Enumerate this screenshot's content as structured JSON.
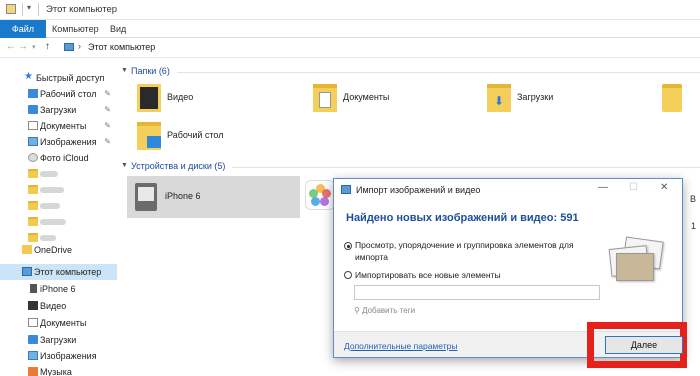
{
  "window": {
    "title": "Этот компьютер"
  },
  "ribbon": {
    "tabs": [
      "Файл",
      "Компьютер",
      "Вид"
    ]
  },
  "address": {
    "path": "Этот компьютер"
  },
  "nav": {
    "quick_access": "Быстрый доступ",
    "quick_items": [
      "Рабочий стол",
      "Загрузки",
      "Документы",
      "Изображения",
      "Фото iCloud"
    ],
    "onedrive": "OneDrive",
    "this_pc": "Этот компьютер",
    "pc_items": [
      "iPhone 6",
      "Видео",
      "Документы",
      "Загрузки",
      "Изображения",
      "Музыка"
    ]
  },
  "content": {
    "folders_group": "Папки (6)",
    "folders": [
      "Видео",
      "Документы",
      "Загрузки",
      "Рабочий стол"
    ],
    "devices_group": "Устройства и диски (5)",
    "device_selected": "iPhone 6",
    "peek_top": "В",
    "peek_bottom": "1"
  },
  "dialog": {
    "title": "Импорт изображений и видео",
    "heading": "Найдено новых изображений и видео: 591",
    "option1": "Просмотр, упорядочение и группировка элементов для импорта",
    "option2": "Импортировать все новые элементы",
    "add_tags": "Добавить теги",
    "more_options": "Дополнительные параметры",
    "next_button": "Далее"
  },
  "colors": {
    "accent": "#1979ca",
    "highlight": "#e4211b",
    "heading": "#1f4e9c"
  }
}
